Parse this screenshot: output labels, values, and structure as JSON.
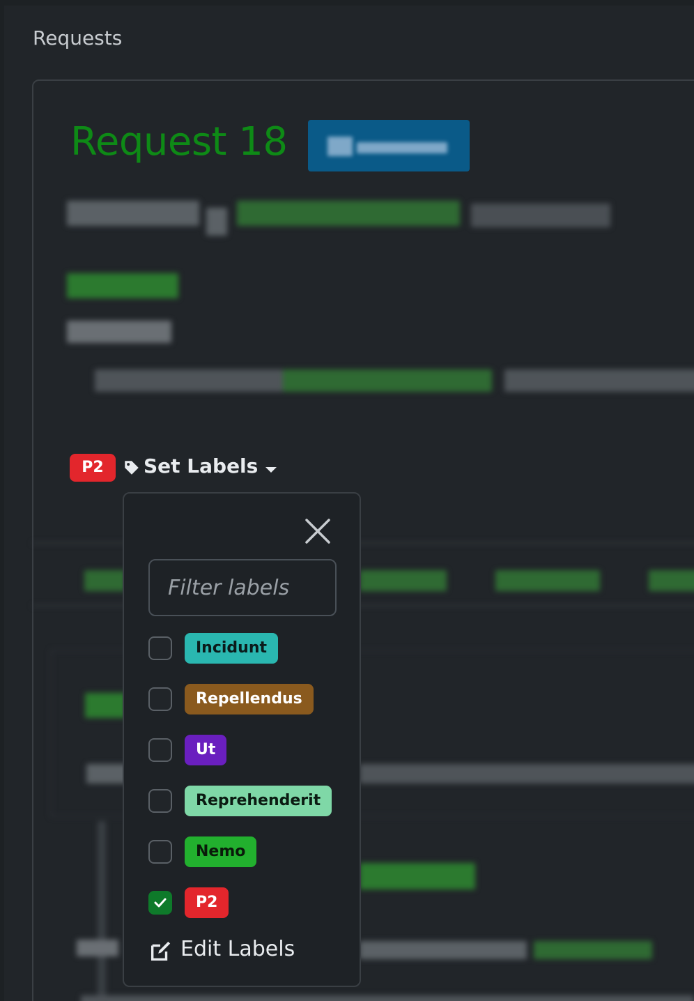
{
  "breadcrumb": {
    "text": "Requests"
  },
  "request": {
    "title": "Request 18"
  },
  "labels": {
    "current_badge": "P2",
    "set_labels": "Set Labels"
  },
  "dropdown": {
    "filter_placeholder": "Filter labels",
    "items": [
      {
        "label": "Incidunt",
        "checked": false,
        "bg": "#2ab7b0",
        "fg": "#0b1b1b"
      },
      {
        "label": "Repellendus",
        "checked": false,
        "bg": "#8a5a1e",
        "fg": "#ffffff"
      },
      {
        "label": "Ut",
        "checked": false,
        "bg": "#6a1fbf",
        "fg": "#ffffff"
      },
      {
        "label": "Reprehenderit",
        "checked": false,
        "bg": "#7fd8a7",
        "fg": "#0b1b12"
      },
      {
        "label": "Nemo",
        "checked": false,
        "bg": "#22b02e",
        "fg": "#0a1a0a"
      },
      {
        "label": "P2",
        "checked": true,
        "bg": "#e3262c",
        "fg": "#ffffff"
      }
    ],
    "edit_labels": "Edit Labels"
  },
  "colors": {
    "background": "#212529",
    "title_green": "#0e8a16",
    "status_blue": "#0a5a88"
  }
}
